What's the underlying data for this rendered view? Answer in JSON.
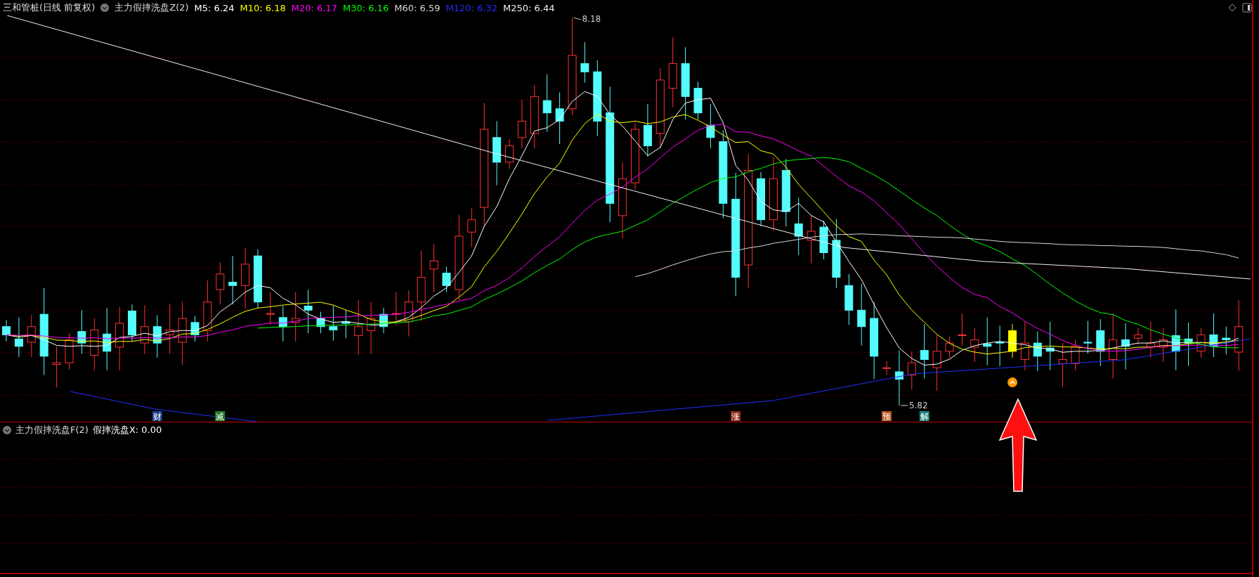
{
  "chart": {
    "title": "三和管桩(日线 前复权)",
    "indicator": "主力假摔洗盘Z(2)",
    "moving_averages": [
      {
        "label": "M5: 6.24",
        "color": "#ffffff"
      },
      {
        "label": "M10: 6.18",
        "color": "#ffff00"
      },
      {
        "label": "M20: 6.17",
        "color": "#ff00ff"
      },
      {
        "label": "M30: 6.16",
        "color": "#00ff00"
      },
      {
        "label": "M60: 6.59",
        "color": "#d8d8d8"
      },
      {
        "label": "M120: 6.32",
        "color": "#1f2fff"
      },
      {
        "label": "M250: 6.44",
        "color": "#f0f0f0"
      }
    ],
    "high_label": "8.18",
    "low_label": "5.82",
    "signals": [
      {
        "text": "财",
        "color": "#1c3f8c"
      },
      {
        "text": "减",
        "color": "#1f7a2a"
      },
      {
        "text": "涨",
        "color": "#8c2a1c"
      },
      {
        "text": "预",
        "color": "#b5501a"
      },
      {
        "text": "解",
        "color": "#1a8080"
      }
    ]
  },
  "sub_panel": {
    "indicator": "主力假摔洗盘F(2)",
    "reading": "假摔洗盘X: 0.00"
  }
}
